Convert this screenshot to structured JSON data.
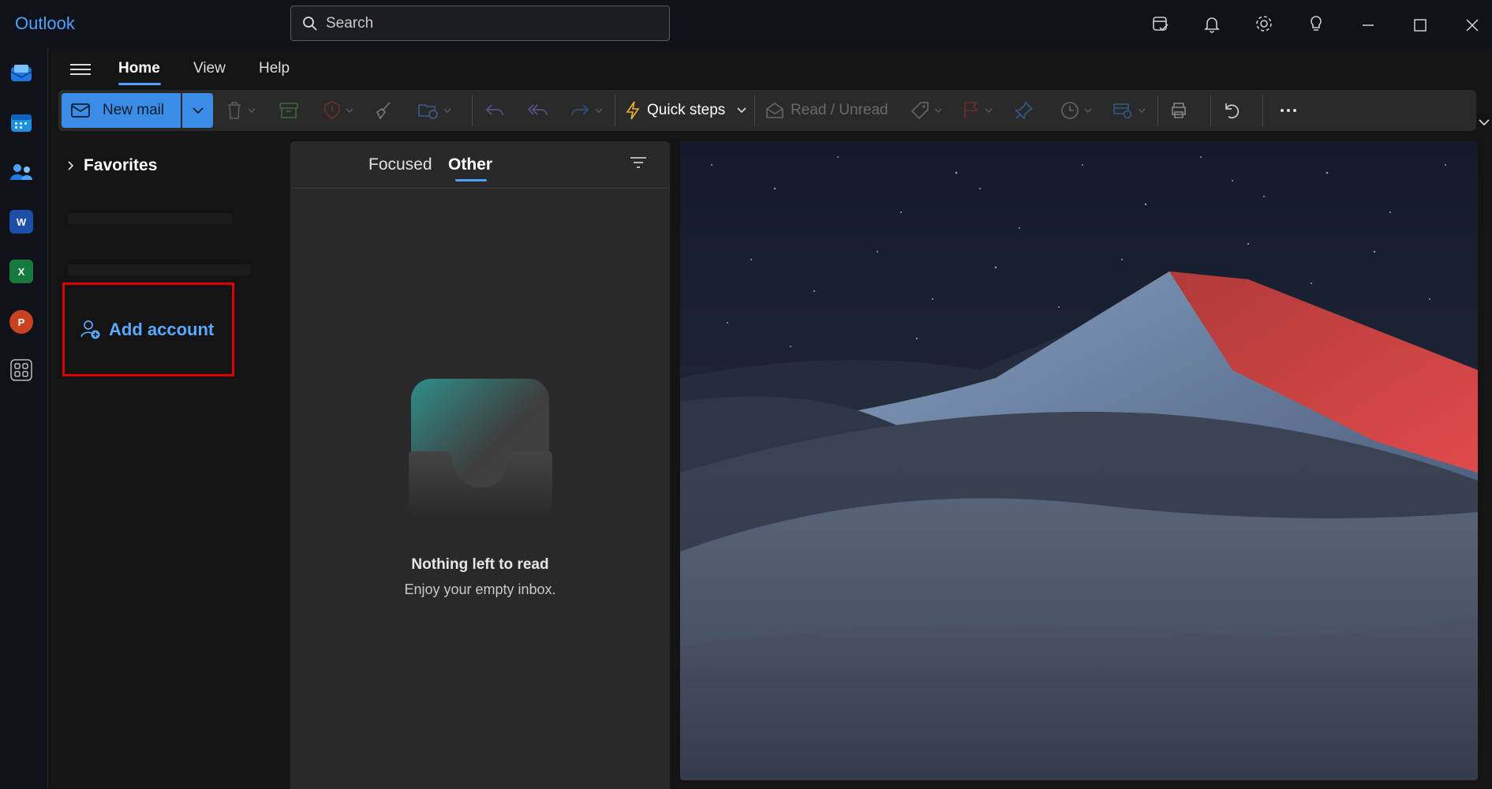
{
  "app": {
    "title": "Outlook"
  },
  "search": {
    "placeholder": "Search"
  },
  "titlebar_icons": [
    "my-day-icon",
    "bell-icon",
    "gear-icon",
    "lightbulb-icon"
  ],
  "window_controls": [
    "minimize-icon",
    "maximize-icon",
    "close-icon"
  ],
  "rail": {
    "items": [
      {
        "name": "mail",
        "glyph": ""
      },
      {
        "name": "calendar",
        "glyph": ""
      },
      {
        "name": "people",
        "glyph": ""
      },
      {
        "name": "word",
        "glyph": "W"
      },
      {
        "name": "excel",
        "glyph": "X"
      },
      {
        "name": "powerpoint",
        "glyph": "P"
      },
      {
        "name": "more-apps",
        "glyph": ""
      }
    ]
  },
  "ribbon": {
    "tabs": [
      {
        "label": "Home",
        "active": true
      },
      {
        "label": "View",
        "active": false
      },
      {
        "label": "Help",
        "active": false
      }
    ],
    "new_mail_label": "New mail",
    "quick_steps_label": "Quick steps",
    "read_unread_label": "Read / Unread"
  },
  "folders": {
    "favorites_label": "Favorites",
    "add_account_label": "Add account"
  },
  "message_list": {
    "tabs": [
      {
        "label": "Focused",
        "active": false
      },
      {
        "label": "Other",
        "active": true
      }
    ],
    "empty_title": "Nothing left to read",
    "empty_subtitle": "Enjoy your empty inbox."
  },
  "colors": {
    "accent": "#4da3ff",
    "new_mail_button": "#3b8ce6",
    "highlight_box": "#e00000"
  }
}
